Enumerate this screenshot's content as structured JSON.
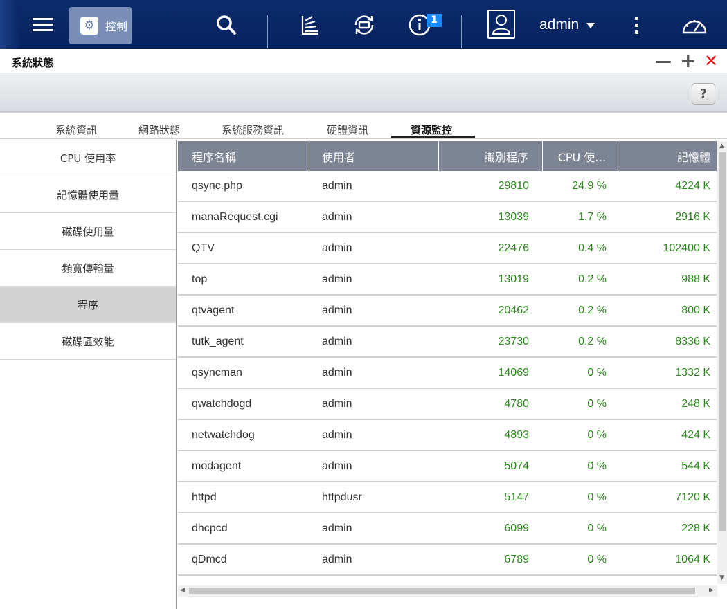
{
  "topbar": {
    "app_label": "控制",
    "notification_count": "1",
    "user": "admin"
  },
  "window": {
    "title": "系統狀態",
    "minimize": "—",
    "maximize": "+",
    "close": "✕",
    "help": "?"
  },
  "tabs": [
    "系統資訊",
    "網路狀態",
    "系統服務資訊",
    "硬體資訊",
    "資源監控"
  ],
  "active_tab": 4,
  "sidebar": {
    "items": [
      "CPU 使用率",
      "記憶體使用量",
      "磁碟使用量",
      "頻寬傳輸量",
      "程序",
      "磁碟區效能"
    ],
    "active": 4
  },
  "table": {
    "headers": [
      "程序名稱",
      "使用者",
      "識別程序",
      "CPU 使…",
      "記憶體"
    ],
    "rows": [
      [
        "qsync.php",
        "admin",
        "29810",
        "24.9 %",
        "4224 K"
      ],
      [
        "manaRequest.cgi",
        "admin",
        "13039",
        "1.7 %",
        "2916 K"
      ],
      [
        "QTV",
        "admin",
        "22476",
        "0.4 %",
        "102400 K"
      ],
      [
        "top",
        "admin",
        "13019",
        "0.2 %",
        "988 K"
      ],
      [
        "qtvagent",
        "admin",
        "20462",
        "0.2 %",
        "800 K"
      ],
      [
        "tutk_agent",
        "admin",
        "23730",
        "0.2 %",
        "8336 K"
      ],
      [
        "qsyncman",
        "admin",
        "14069",
        "0 %",
        "1332 K"
      ],
      [
        "qwatchdogd",
        "admin",
        "4780",
        "0 %",
        "248 K"
      ],
      [
        "netwatchdog",
        "admin",
        "4893",
        "0 %",
        "424 K"
      ],
      [
        "modagent",
        "admin",
        "5074",
        "0 %",
        "544 K"
      ],
      [
        "httpd",
        "httpdusr",
        "5147",
        "0 %",
        "7120 K"
      ],
      [
        "dhcpcd",
        "admin",
        "6099",
        "0 %",
        "228 K"
      ],
      [
        "qDmcd",
        "admin",
        "6789",
        "0 %",
        "1064 K"
      ]
    ]
  }
}
